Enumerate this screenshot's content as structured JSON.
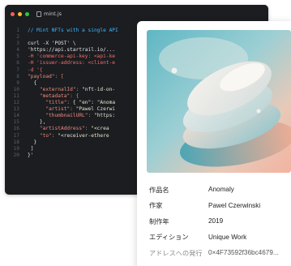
{
  "editor": {
    "filename": "mint.js",
    "file_icon": "file-icon",
    "lines": [
      {
        "n": "1",
        "parts": [
          [
            "c-comment",
            "// Mint NFTs with a single API"
          ]
        ]
      },
      {
        "n": "2",
        "parts": []
      },
      {
        "n": "3",
        "parts": [
          [
            "c-white",
            "curl -X 'POST' \\"
          ]
        ]
      },
      {
        "n": "4",
        "parts": [
          [
            "c-white",
            "'https://api.startrail.io/..."
          ]
        ]
      },
      {
        "n": "5",
        "parts": [
          [
            "c-orange",
            "-H 'commerce-api-key: <api-ke"
          ]
        ]
      },
      {
        "n": "6",
        "parts": [
          [
            "c-orange",
            "-H 'issuer-address: <client-e"
          ]
        ]
      },
      {
        "n": "7",
        "parts": [
          [
            "c-orange",
            "-d '{"
          ]
        ]
      },
      {
        "n": "8",
        "parts": [
          [
            "c-key",
            "\"payload\": ["
          ]
        ]
      },
      {
        "n": "9",
        "parts": [
          [
            "c-white",
            "  {"
          ]
        ]
      },
      {
        "n": "10",
        "parts": [
          [
            "c-key",
            "    \"externalId\": "
          ],
          [
            "c-str",
            "\"nft-id-on-"
          ]
        ]
      },
      {
        "n": "11",
        "parts": [
          [
            "c-key",
            "    \"metadata\": {"
          ]
        ]
      },
      {
        "n": "12",
        "parts": [
          [
            "c-key",
            "      \"title\": "
          ],
          [
            "c-str",
            "{ \"en\": \"Anoma"
          ]
        ]
      },
      {
        "n": "13",
        "parts": [
          [
            "c-key",
            "      \"artist\": "
          ],
          [
            "c-str",
            "\"Pawel Czerwi"
          ]
        ]
      },
      {
        "n": "14",
        "parts": [
          [
            "c-key",
            "      \"thumbnailURL\": "
          ],
          [
            "c-str",
            "\"https:"
          ]
        ]
      },
      {
        "n": "15",
        "parts": [
          [
            "c-white",
            "    },"
          ]
        ]
      },
      {
        "n": "16",
        "parts": [
          [
            "c-key",
            "    \"artistAddress\": "
          ],
          [
            "c-str",
            "\"<crea"
          ]
        ]
      },
      {
        "n": "17",
        "parts": [
          [
            "c-key",
            "    \"to\": "
          ],
          [
            "c-str",
            "\"<receiver-ethere"
          ]
        ]
      },
      {
        "n": "18",
        "parts": [
          [
            "c-white",
            "  }"
          ]
        ]
      },
      {
        "n": "19",
        "parts": [
          [
            "c-white",
            " ]"
          ]
        ]
      },
      {
        "n": "20",
        "parts": [
          [
            "c-white",
            "}'"
          ]
        ]
      }
    ]
  },
  "card": {
    "rows": [
      {
        "key": "作品名",
        "value": "Anomaly"
      },
      {
        "key": "作家",
        "value": "Pawel Czerwinski"
      },
      {
        "key": "制作年",
        "value": "2019"
      },
      {
        "key": "エディション",
        "value": "Unique Work"
      },
      {
        "key": "アドレスへの発行",
        "value": "0×4F73592f36bc4679..."
      }
    ]
  },
  "colors": {
    "editor_bg": "#1b1d20",
    "comment": "#3fb6ff",
    "flag": "#f26d6d",
    "json_key": "#f08a7e"
  }
}
